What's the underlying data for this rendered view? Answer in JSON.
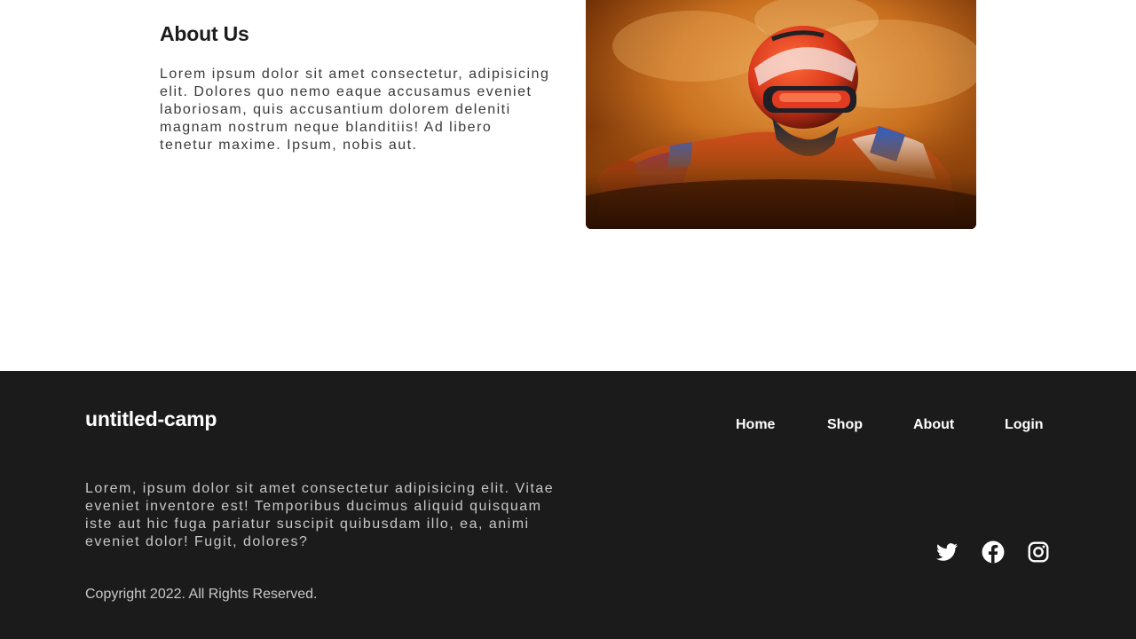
{
  "about": {
    "title": "About Us",
    "body": "Lorem ipsum dolor sit amet consectetur, adipisicing elit. Dolores quo nemo eaque accusamus eveniet laboriosam, quis accusantium dolorem deleniti magnam nostrum neque blanditiis! Ad libero tenetur maxime. Ipsum, nobis aut.",
    "image_subject": "motocross rider in helmet and goggles against orange dusty sky"
  },
  "footer": {
    "brand": "untitled-camp",
    "nav": [
      "Home",
      "Shop",
      "About",
      "Login"
    ],
    "description": "Lorem, ipsum dolor sit amet consectetur adipisicing elit. Vitae eveniet inventore est! Temporibus ducimus aliquid quisquam iste aut hic fuga pariatur suscipit quibusdam illo, ea, animi eveniet dolor! Fugit, dolores?",
    "copyright": "Copyright 2022. All Rights Reserved.",
    "social_icons": [
      "twitter-icon",
      "facebook-icon",
      "instagram-icon"
    ]
  },
  "colors": {
    "footer_bg": "#1b1b1c",
    "text_dark": "#1c1c1c",
    "text_light": "#c8c8c8"
  }
}
